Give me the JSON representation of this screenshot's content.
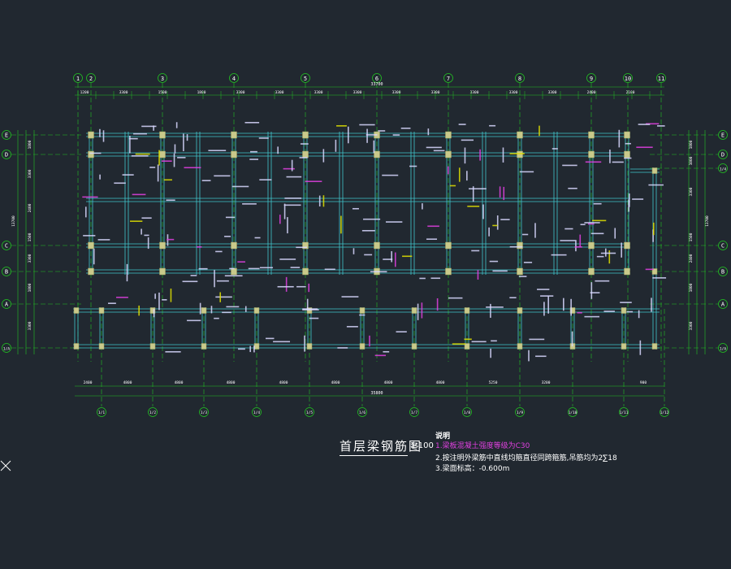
{
  "drawing": {
    "title": "首层梁钢筋图",
    "scale": "1:100",
    "notes_heading": "说明",
    "notes": [
      "1.梁板混凝土强度等级为C30",
      "2.按注明外梁筋中直线均箍直径同跨箍筋,吊筋均为2∑18",
      "3.梁面标高：-0.600m"
    ],
    "top_axes": [
      "1",
      "2",
      "3",
      "4",
      "5",
      "6",
      "7",
      "8",
      "9",
      "10",
      "11"
    ],
    "left_axes": [
      "E",
      "D",
      "C",
      "B",
      "A",
      "1/A"
    ],
    "right_axes": [
      "E",
      "D",
      "1/4",
      "C",
      "B",
      "A",
      "1/A"
    ],
    "bottom_axes": [
      "1/1",
      "1/2",
      "1/3",
      "1/4",
      "1/5",
      "1/6",
      "1/7",
      "1/8",
      "1/9",
      "1/10",
      "1/11",
      "1/12"
    ],
    "top_total_dim": "33700",
    "top_spans": [
      "1200",
      "3300",
      "1500",
      "1800",
      "3300",
      "3300",
      "3300",
      "3300",
      "3300",
      "3300",
      "3300",
      "3300",
      "3300",
      "2400",
      "2100"
    ],
    "bottom_spans": [
      "2400",
      "4800",
      "4800",
      "4800",
      "4800",
      "4800",
      "4800",
      "4800",
      "5250",
      "3200",
      "900"
    ],
    "bottom_total_dim": "35800",
    "left_dims": [
      "1800",
      "3300",
      "2400",
      "1500",
      "3300",
      "1800",
      "3300"
    ],
    "left_total_dim": "13700",
    "right_dims": [
      "1800",
      "1000",
      "3300",
      "1500",
      "2400",
      "1800",
      "3300"
    ],
    "right_total_dim": "13700",
    "colors": {
      "background": "#212830",
      "axis": "#22c222",
      "beam": "#41c6cc",
      "column": "#c9c98a",
      "annotation_primary": "#d8d8ff",
      "annotation_secondary": "#e040e0",
      "highlight": "#e0e000"
    }
  }
}
